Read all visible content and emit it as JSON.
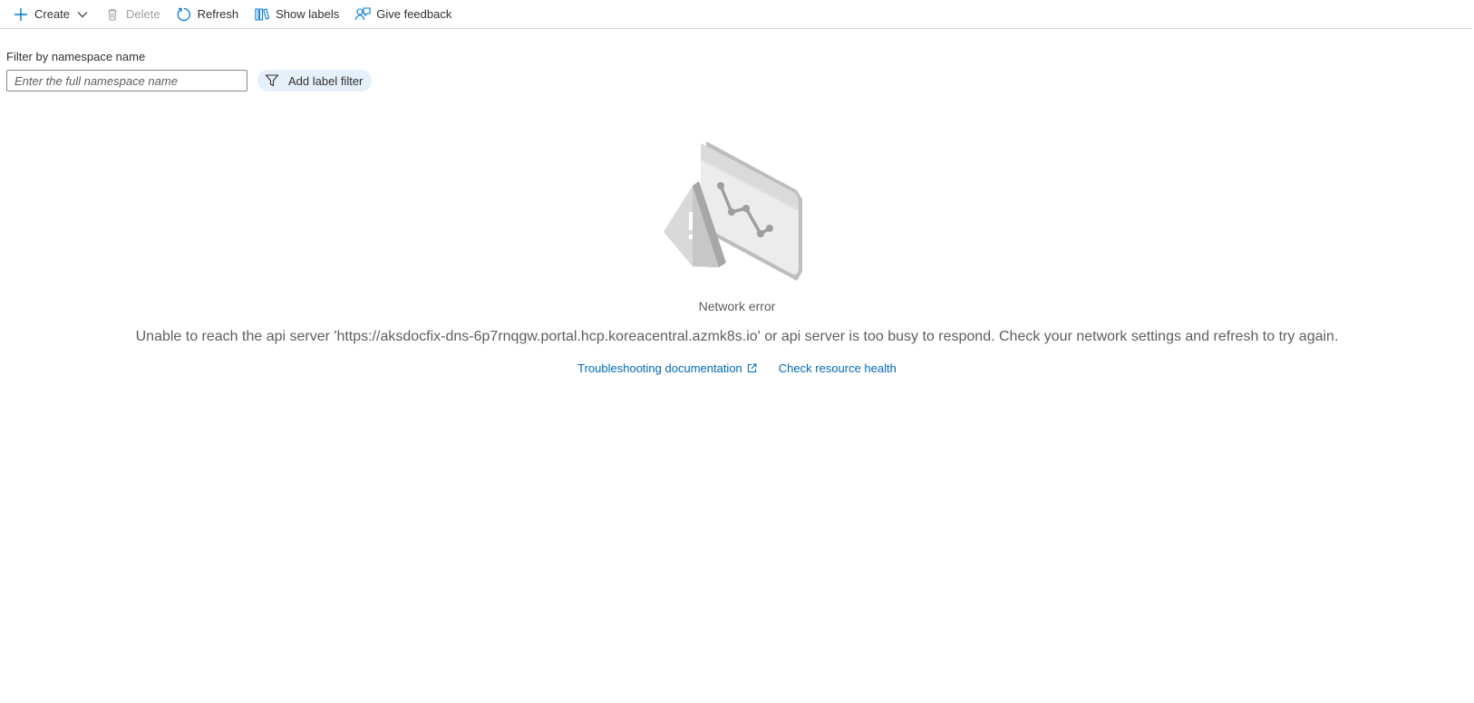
{
  "toolbar": {
    "create_label": "Create",
    "delete_label": "Delete",
    "refresh_label": "Refresh",
    "show_labels_label": "Show labels",
    "feedback_label": "Give feedback"
  },
  "filter": {
    "label": "Filter by namespace name",
    "placeholder": "Enter the full namespace name",
    "value": "",
    "add_label_filter": "Add label filter"
  },
  "error": {
    "illustration": "network-error-illustration",
    "title": "Network error",
    "message": "Unable to reach the api server 'https://aksdocfix-dns-6p7rnqgw.portal.hcp.koreacentral.azmk8s.io' or api server is too busy to respond. Check your network settings and refresh to try again.",
    "troubleshooting_link": "Troubleshooting documentation",
    "health_link": "Check resource health"
  },
  "colors": {
    "accent": "#0067b8",
    "icon_blue": "#0078d4",
    "text": "#323130",
    "muted_text": "#605e5c",
    "disabled_text": "#a19f9d",
    "filter_pill_bg": "#e6f0fa",
    "divider": "#d1d1d1"
  },
  "icons": {
    "create": "plus-icon",
    "create_menu": "chevron-down-icon",
    "delete": "trash-icon",
    "refresh": "refresh-icon",
    "show_labels": "labels-icon",
    "feedback": "feedback-icon",
    "label_filter": "funnel-icon",
    "external": "external-link-icon"
  }
}
